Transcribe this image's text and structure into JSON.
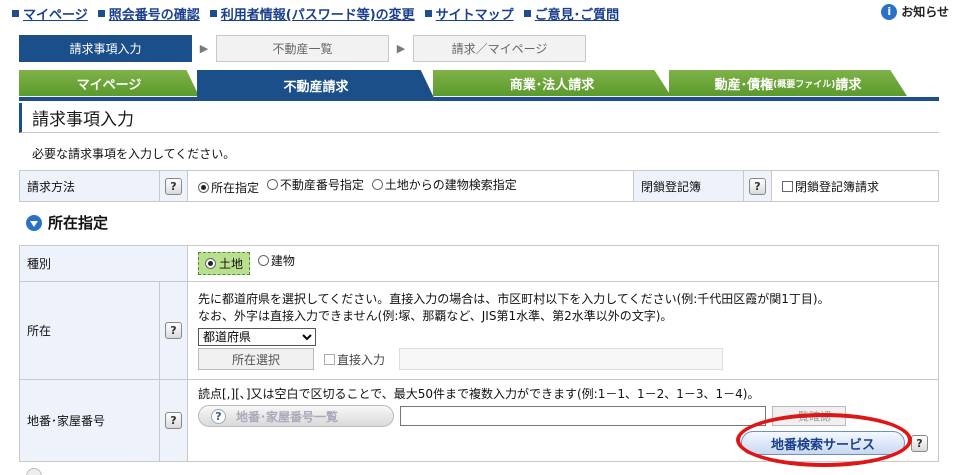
{
  "topnav": {
    "links": [
      "マイページ",
      "照会番号の確認",
      "利用者情報(パスワード等)の変更",
      "サイトマップ",
      "ご意見･ご質問"
    ],
    "notice": "お知らせ",
    "info_icon": "info-icon"
  },
  "steps": [
    "請求事項入力",
    "不動産一覧",
    "請求／マイページ"
  ],
  "tabs": {
    "mypage": "マイページ",
    "realestate": "不動産請求",
    "corporate": "商業･法人請求",
    "movable_main": "動産･債権",
    "movable_small": "(概要ファイル)",
    "movable_suffix": "請求"
  },
  "page_title": "請求事項入力",
  "intro": "必要な請求事項を入力してください。",
  "method_row": {
    "label": "請求方法",
    "help": "?",
    "options": [
      "所在指定",
      "不動産番号指定",
      "土地からの建物検索指定"
    ],
    "selected": "所在指定",
    "closed_label": "閉鎖登記簿",
    "closed_help": "?",
    "closed_checkbox": "閉鎖登記簿請求"
  },
  "section": {
    "title": "所在指定"
  },
  "kind_row": {
    "label": "種別",
    "options": [
      "土地",
      "建物"
    ],
    "selected": "土地"
  },
  "location_row": {
    "label": "所在",
    "help": "?",
    "line1": "先に都道府県を選択してください。直接入力の場合は、市区町村以下を入力してください(例:千代田区霞が関1丁目)。",
    "line2": "なお、外字は直接入力できません(例:塚、那覇など、JIS第1水準、第2水準以外の文字)。",
    "prefecture_select": "都道府県",
    "select_button": "所在選択",
    "direct_checkbox": "直接入力"
  },
  "lot_row": {
    "label": "地番･家屋番号",
    "help": "?",
    "note": "読点[,][､]又は空白で区切ることで、最大50件まで複数入力ができます(例:1－1、1－2、1－3、1－4)。",
    "list_button": "地番･家屋番号一覧",
    "list_button_help": "?",
    "confirm_button": "一覧確認",
    "search_button": "地番検索サービス",
    "search_help": "?"
  },
  "colors": {
    "brand_blue": "#1b4f8a",
    "tab_green": "#6aa637",
    "highlight": "#e01515"
  }
}
